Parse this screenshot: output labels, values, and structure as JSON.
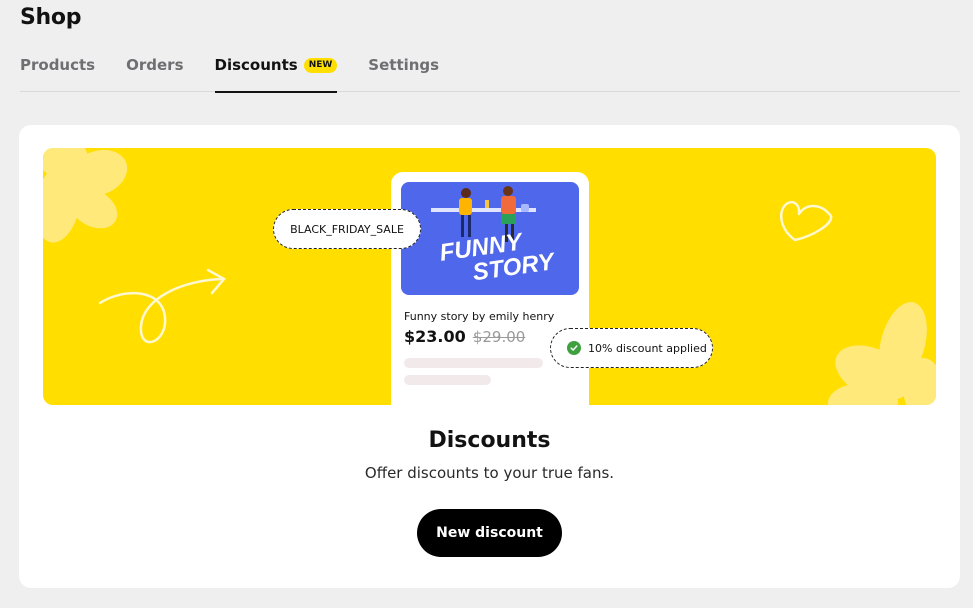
{
  "header": {
    "title": "Shop"
  },
  "tabs": [
    {
      "label": "Products",
      "active": false
    },
    {
      "label": "Orders",
      "active": false
    },
    {
      "label": "Discounts",
      "active": true,
      "badge": "NEW"
    },
    {
      "label": "Settings",
      "active": false
    }
  ],
  "banner": {
    "coupon_code": "BLACK_FRIDAY_SALE",
    "product_title": "Funny story by emily henry",
    "price": "$23.00",
    "original_price": "$29.00",
    "applied_label": "10% discount applied",
    "cover_title_line1": "FUNNY",
    "cover_title_line2": "STORY",
    "colors": {
      "banner": "#ffde00",
      "cover": "#4f67ea",
      "check": "#3fa03f",
      "deco": "#ffe97a"
    }
  },
  "empty_state": {
    "title": "Discounts",
    "description": "Offer discounts to your true fans.",
    "button_label": "New discount"
  },
  "icons": [
    "flower-decoration",
    "arrow-doodle-icon",
    "heart-doodle-icon",
    "check-circle-icon"
  ]
}
